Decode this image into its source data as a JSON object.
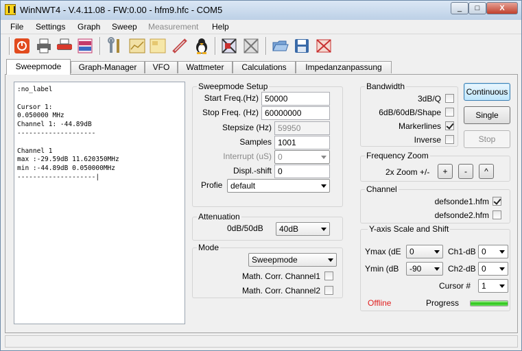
{
  "window": {
    "title": "WinNWT4 - V.4.11.08 - FW:0.00 - hfm9.hfc - COM5",
    "minimize": "_",
    "maximize": "□",
    "close": "X"
  },
  "menu": [
    "File",
    "Settings",
    "Graph",
    "Sweep",
    "Measurement",
    "Help"
  ],
  "menu_disabled": "Measurement",
  "toolbar": [
    {
      "icon": "power-icon",
      "color": "#e24b1e"
    },
    {
      "icon": "printer-icon",
      "color": "#555555"
    },
    {
      "icon": "print-pdf-icon",
      "color": "#d83a2c"
    },
    {
      "icon": "png-bmp-icon",
      "color": "#c43a6a"
    },
    {
      "icon": "tools-icon",
      "color": "#6a7a8a"
    },
    {
      "icon": "frame-icon",
      "color": "#c9a34a"
    },
    {
      "icon": "chart-icon",
      "color": "#d8b84c"
    },
    {
      "icon": "probe-icon",
      "color": "#c44848"
    },
    {
      "icon": "tux-icon",
      "color": "#222222"
    },
    {
      "icon": "crossed-frame-icon",
      "color": "#3a3a3a"
    },
    {
      "icon": "crossed-frame-2-icon",
      "color": "#777777"
    },
    {
      "icon": "open-folder-icon",
      "color": "#4a7ab0"
    },
    {
      "icon": "save-disk-icon",
      "color": "#3a6aa8"
    },
    {
      "icon": "crossed-red-icon",
      "color": "#c83030"
    }
  ],
  "tabs": [
    "Sweepmode",
    "Graph-Manager",
    "VFO",
    "Wattmeter",
    "Calculations",
    "Impedanzanpassung"
  ],
  "active_tab": "Sweepmode",
  "log_text": ":no_label\n\nCursor 1:\n0.050000 MHz\nChannel 1: -44.89dB\n--------------------\n\nChannel 1\nmax :-29.59dB 11.620350MHz\nmin :-44.89dB 0.050000MHz\n--------------------|",
  "sweep_setup": {
    "title": "Sweepmode Setup",
    "start_label": "Start Freq.(Hz)",
    "start_value": "50000",
    "stop_label": "Stop Freq. (Hz)",
    "stop_value": "60000000",
    "step_label": "Stepsize (Hz)",
    "step_value": "59950",
    "samples_label": "Samples",
    "samples_value": "1001",
    "interrupt_label": "Interrupt (uS)",
    "interrupt_value": "0",
    "displ_label": "Displ.-shift",
    "displ_value": "0",
    "profile_label": "Profie",
    "profile_value": "default"
  },
  "attenuation": {
    "title": "Attenuation",
    "label": "0dB/50dB",
    "value": "40dB"
  },
  "mode": {
    "title": "Mode",
    "value": "Sweepmode",
    "math1": "Math. Corr. Channel1",
    "math2": "Math. Corr. Channel2"
  },
  "bandwidth": {
    "title": "Bandwidth",
    "items": [
      {
        "label": "3dB/Q",
        "checked": false
      },
      {
        "label": "6dB/60dB/Shape",
        "checked": false
      },
      {
        "label": "Markerlines",
        "checked": true
      },
      {
        "label": "Inverse",
        "checked": false
      }
    ]
  },
  "buttons": {
    "continuous": "Continuous",
    "single": "Single",
    "stop": "Stop"
  },
  "frequency_zoom": {
    "title": "Frequency Zoom",
    "label": "2x Zoom +/-",
    "plus": "+",
    "minus": "-",
    "reset": "^"
  },
  "channel": {
    "title": "Channel",
    "items": [
      {
        "label": "defsonde1.hfm",
        "checked": true
      },
      {
        "label": "defsonde2.hfm",
        "checked": false
      }
    ]
  },
  "yaxis": {
    "title": "Y-axis Scale and Shift",
    "ymax_label": "Ymax (dE",
    "ymax_value": "0",
    "ymin_label": "Ymin (dB",
    "ymin_value": "-90",
    "ch1_label": "Ch1-dB",
    "ch1_value": "0",
    "ch2_label": "Ch2-dB",
    "ch2_value": "0",
    "cursor_label": "Cursor #",
    "cursor_value": "1",
    "status": "Offline",
    "status_color": "#e02020",
    "progress_label": "Progress",
    "progress_fraction": 1.0
  }
}
